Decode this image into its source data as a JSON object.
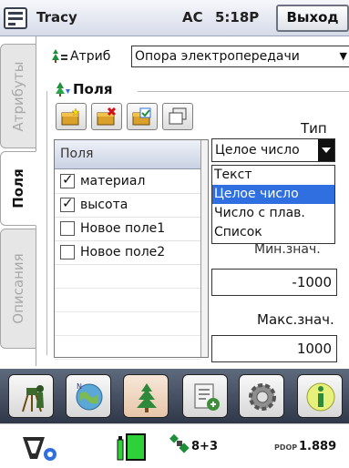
{
  "titlebar": {
    "app_title": "Tracy",
    "power_mode": "AC",
    "clock": "5:18P",
    "exit_label": "Выход"
  },
  "tabs": [
    {
      "label": "Атрибуты",
      "active": false
    },
    {
      "label": "Поля",
      "active": true
    },
    {
      "label": "Описания",
      "active": false
    }
  ],
  "attributes": {
    "label": "Атриб",
    "layer_value": "Опора электропередачи"
  },
  "fields": {
    "group_label": "Поля",
    "list_header": "Поля",
    "items": [
      {
        "name": "материал",
        "checked": true
      },
      {
        "name": "высота",
        "checked": true
      },
      {
        "name": "Новое поле1",
        "checked": false
      },
      {
        "name": "Новое поле2",
        "checked": false
      }
    ]
  },
  "type": {
    "label": "Тип",
    "value": "Целое число",
    "options": [
      "Текст",
      "Целое число",
      "Число с плав.",
      "Список"
    ],
    "selected_index": 1
  },
  "min": {
    "label": "Мин.знач.",
    "value": "-1000"
  },
  "max": {
    "label": "Макс.знач.",
    "value": "1000"
  },
  "status": {
    "satellites": "8+3",
    "pdop_label": "PDOP",
    "pdop_value": "1.889"
  },
  "colors": {
    "accent": "#2f6fe0",
    "toolbar": "#3a4457",
    "battery": "#2fd13a"
  },
  "icons": [
    "start-menu-icon",
    "layer-tree-icon",
    "new-field-icon",
    "delete-field-icon",
    "edit-field-icon",
    "copy-field-icon",
    "survey-icon",
    "map-icon",
    "tree-icon",
    "files-icon",
    "settings-icon",
    "info-icon",
    "gps-receiver-icon",
    "battery-icon",
    "satellite-icon"
  ]
}
